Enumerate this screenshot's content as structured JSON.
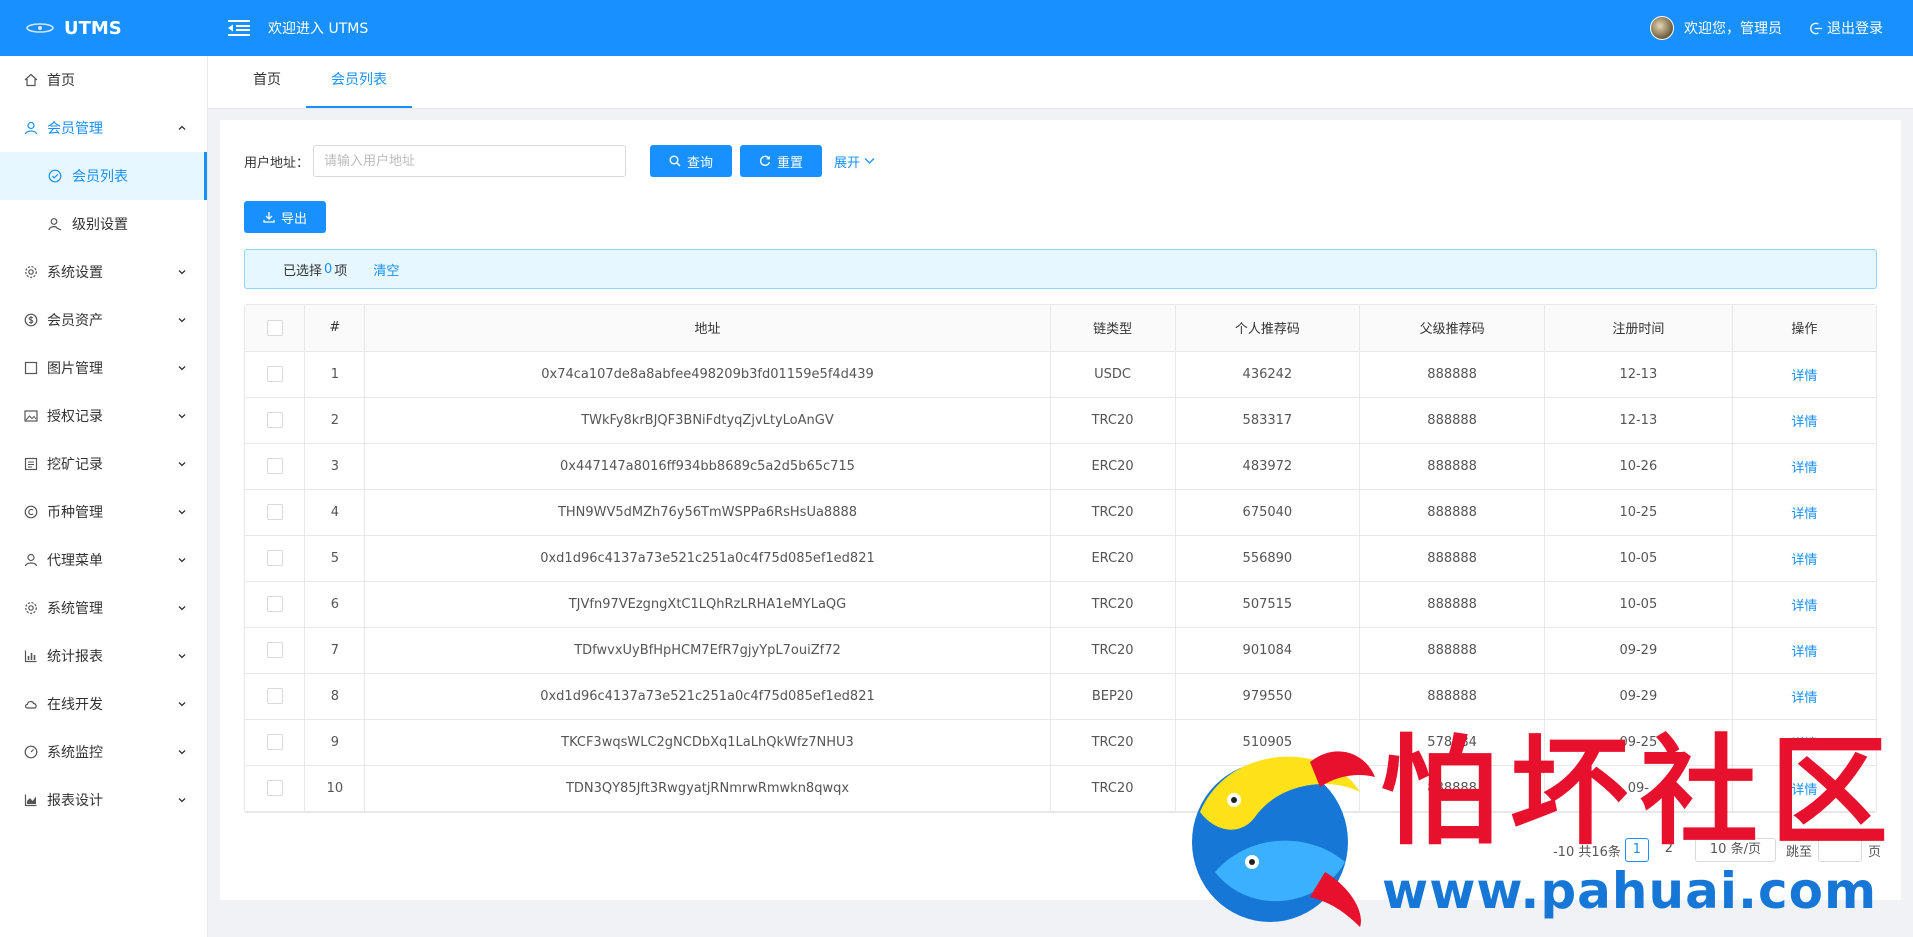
{
  "header": {
    "logo_text": "UTMS",
    "welcome": "欢迎进入 UTMS",
    "user_greeting": "欢迎您，管理员",
    "logout_label": "退出登录"
  },
  "sidebar": {
    "home": "首页",
    "member_mgmt": "会员管理",
    "member_list": "会员列表",
    "level_settings": "级别设置",
    "items": [
      {
        "label": "系统设置",
        "icon": "gear-icon"
      },
      {
        "label": "会员资产",
        "icon": "dollar-icon"
      },
      {
        "label": "图片管理",
        "icon": "square-icon"
      },
      {
        "label": "授权记录",
        "icon": "image-icon"
      },
      {
        "label": "挖矿记录",
        "icon": "list-icon"
      },
      {
        "label": "币种管理",
        "icon": "copyright-icon"
      },
      {
        "label": "代理菜单",
        "icon": "user-icon"
      },
      {
        "label": "系统管理",
        "icon": "gear-icon"
      },
      {
        "label": "统计报表",
        "icon": "bar-chart-icon"
      },
      {
        "label": "在线开发",
        "icon": "cloud-icon"
      },
      {
        "label": "系统监控",
        "icon": "dashboard-icon"
      },
      {
        "label": "报表设计",
        "icon": "area-chart-icon"
      }
    ]
  },
  "tabs": {
    "home": "首页",
    "member_list": "会员列表"
  },
  "search": {
    "label": "用户地址：",
    "placeholder": "请输入用户地址",
    "query_label": "查询",
    "reset_label": "重置",
    "expand_label": "展开"
  },
  "toolbar": {
    "export_label": "导出"
  },
  "alert": {
    "prefix": "已选择",
    "count": "0",
    "suffix": "项",
    "clear_label": "清空"
  },
  "table": {
    "headers": {
      "index": "#",
      "address": "地址",
      "chain": "链类型",
      "ref_code": "个人推荐码",
      "parent_code": "父级推荐码",
      "reg_time": "注册时间",
      "action": "操作"
    },
    "rows": [
      {
        "index": "1",
        "address": "0x74ca107de8a8abfee498209b3fd01159e5f4d439",
        "chain": "USDC",
        "ref_code": "436242",
        "parent_code": "888888",
        "reg_time": "12-13",
        "action": "详情"
      },
      {
        "index": "2",
        "address": "TWkFy8krBJQF3BNiFdtyqZjvLtyLoAnGV",
        "chain": "TRC20",
        "ref_code": "583317",
        "parent_code": "888888",
        "reg_time": "12-13",
        "action": "详情"
      },
      {
        "index": "3",
        "address": "0x447147a8016ff934bb8689c5a2d5b65c715",
        "chain": "ERC20",
        "ref_code": "483972",
        "parent_code": "888888",
        "reg_time": "10-26",
        "action": "详情"
      },
      {
        "index": "4",
        "address": "THN9WV5dMZh76y56TmWSPPa6RsHsUa8888",
        "chain": "TRC20",
        "ref_code": "675040",
        "parent_code": "888888",
        "reg_time": "10-25",
        "action": "详情"
      },
      {
        "index": "5",
        "address": "0xd1d96c4137a73e521c251a0c4f75d085ef1ed821",
        "chain": "ERC20",
        "ref_code": "556890",
        "parent_code": "888888",
        "reg_time": "10-05",
        "action": "详情"
      },
      {
        "index": "6",
        "address": "TJVfn97VEzgngXtC1LQhRzLRHA1eMYLaQG",
        "chain": "TRC20",
        "ref_code": "507515",
        "parent_code": "888888",
        "reg_time": "10-05",
        "action": "详情"
      },
      {
        "index": "7",
        "address": "TDfwvxUyBfHpHCM7EfR7gjyYpL7ouiZf72",
        "chain": "TRC20",
        "ref_code": "901084",
        "parent_code": "888888",
        "reg_time": "09-29",
        "action": "详情"
      },
      {
        "index": "8",
        "address": "0xd1d96c4137a73e521c251a0c4f75d085ef1ed821",
        "chain": "BEP20",
        "ref_code": "979550",
        "parent_code": "888888",
        "reg_time": "09-29",
        "action": "详情"
      },
      {
        "index": "9",
        "address": "TKCF3wqsWLC2gNCDbXq1LaLhQkWfz7NHU3",
        "chain": "TRC20",
        "ref_code": "510905",
        "parent_code": "578984",
        "reg_time": "09-25",
        "action": "详情"
      },
      {
        "index": "10",
        "address": "TDN3QY85Jft3RwgyatjRNmrwRmwkn8qwqx",
        "chain": "TRC20",
        "ref_code": "",
        "parent_code": "888888",
        "reg_time": "09-",
        "action": "详情"
      }
    ]
  },
  "pagination": {
    "range_text": "-10 共16条",
    "page1": "1",
    "page2": "2",
    "page_size": "10 条/页",
    "goto_label": "跳至",
    "page_suffix": "页"
  },
  "watermark": {
    "title": "怕坏社区",
    "url": "www.pahuai.com"
  }
}
